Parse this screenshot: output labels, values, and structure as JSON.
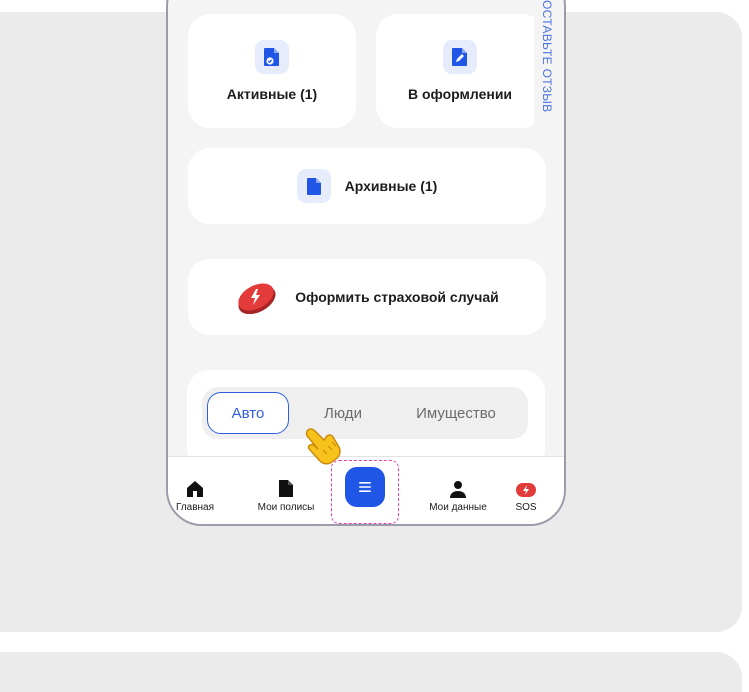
{
  "feedback_tab": "ОСТАВЬТЕ ОТЗЫВ",
  "tiles": {
    "active": "Активные (1)",
    "in_progress": "В оформлении",
    "archived": "Архивные (1)",
    "claim": "Оформить страховой случай"
  },
  "tabs": [
    "Авто",
    "Люди",
    "Имущество"
  ],
  "active_tab": "Авто",
  "nav": {
    "home": "Главная",
    "policies": "Мои полисы",
    "profile": "Мои данные",
    "sos": "SOS"
  },
  "colors": {
    "accent": "#1f56e6",
    "danger": "#e33a3a",
    "highlight": "#e040b8"
  }
}
